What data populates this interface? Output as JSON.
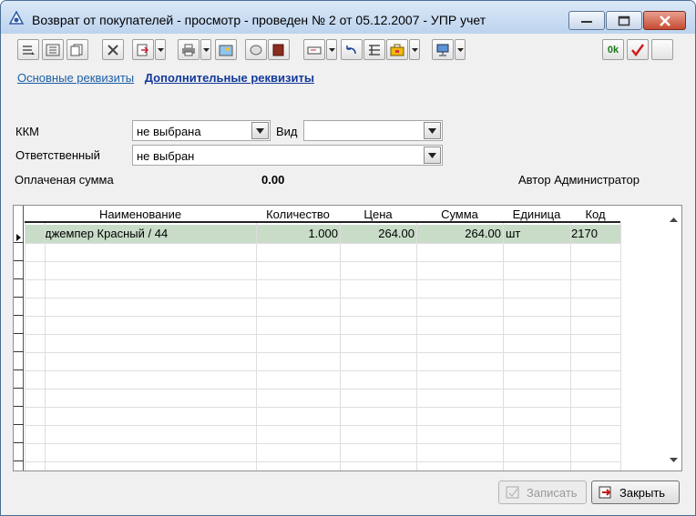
{
  "window": {
    "title": "Возврат от покупателей - просмотр - проведен № 2 от 05.12.2007 - УПР учет"
  },
  "toolbar": {
    "ok_label": "0k"
  },
  "tabs": [
    {
      "label": "Основные реквизиты",
      "active": false
    },
    {
      "label": "Дополнительные реквизиты",
      "active": true
    }
  ],
  "form": {
    "kkm_label": "ККМ",
    "kkm_value": "не выбрана",
    "vid_label": "Вид",
    "vid_value": "",
    "responsible_label": "Ответственный",
    "responsible_value": "не выбран",
    "paid_label": "Оплаченая сумма",
    "paid_value": "0.00",
    "author_label": "Автор",
    "author_value": "Администратор"
  },
  "table": {
    "columns": [
      "Наименование",
      "Количество",
      "Цена",
      "Сумма",
      "Единица",
      "Код"
    ],
    "rows": [
      {
        "name": "джемпер Красный / 44",
        "qty": "1.000",
        "price": "264.00",
        "sum": "264.00",
        "unit": "шт",
        "code": "2170"
      }
    ]
  },
  "buttons": {
    "save": "Записать",
    "close": "Закрыть"
  },
  "colors": {
    "selected_row": "#c8dcc8",
    "link": "#1b5fa8"
  }
}
